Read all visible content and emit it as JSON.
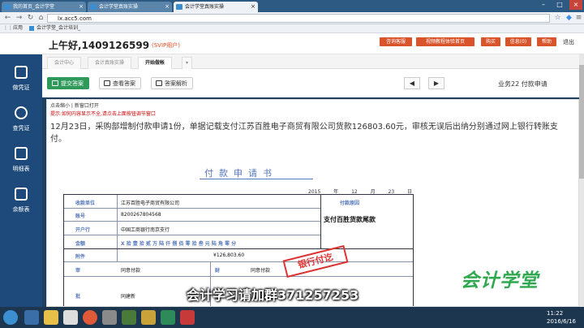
{
  "browser": {
    "tabs": [
      {
        "label": "我的首页_会计学堂"
      },
      {
        "label": "会计学堂真账实操"
      },
      {
        "label": "会计学堂真账实操"
      }
    ],
    "url": "lx.acc5.com",
    "bookmarks": {
      "apps": "应用",
      "item": "会计学堂_会计培训_"
    }
  },
  "header": {
    "greeting": "上午好,1409126599",
    "svip": "(SVIP用户)",
    "buttons": [
      "咨询客服",
      "视频教程体验首页",
      "购买",
      "信息(0)",
      "帮助"
    ],
    "logout": "退出"
  },
  "sidebar": {
    "items": [
      {
        "label": "做凭证"
      },
      {
        "label": "查凭证"
      },
      {
        "label": "明细表"
      },
      {
        "label": "余额表"
      }
    ]
  },
  "tabs": {
    "items": [
      "会计中心",
      "会计真账实操",
      "开始做帐"
    ],
    "dropdown": "▾"
  },
  "toolbar": {
    "submit": "提交答案",
    "view_answer": "查看答案",
    "answer_explain": "答案解析",
    "business_no": "业务22  付款申请"
  },
  "content": {
    "zoom_text": "点击缩小  |  新窗口打开",
    "notice": "提示:如何内容显示不全,请点击上面按钮调节窗口",
    "task": "12月23日，采购部增制付款申请1份，单据记载支付江苏百胜电子商贸有限公司货款126803.60元，审核无误后出纳分别通过网上银行转账支付。"
  },
  "form": {
    "title": "付款申请书",
    "date": "2015 年 12 月 23 日",
    "labels": {
      "payee": "收款单位",
      "account": "账号",
      "bank": "开户行",
      "amount": "金额",
      "attach": "附件",
      "purpose": "付款原因",
      "review": "审",
      "finance": "财",
      "approve": "批"
    },
    "values": {
      "payee": "江苏百胜电子商贸有限公司",
      "account": "8200267804568",
      "bank": "中国工商银行南京支行",
      "amount_words": "X 拾 壹 拾 贰 万 陆 仟 捌 佰 零 拾 叁 元 陆 角 零 分",
      "amount": "¥126,803.60",
      "purpose": "支付百胜货款尾款",
      "review": "同意付款",
      "finance": "同意付款",
      "approve": "同建新",
      "stamp": "银行付讫"
    }
  },
  "overlay": {
    "caption": "会计学习请加群371257253",
    "logo_text": "会计学堂",
    "logo_url": "WWW.ACC5.COM"
  },
  "taskbar": {
    "time": "11:22",
    "date": "2016/6/16"
  },
  "colors": {
    "sidebar": "#1d4a7a",
    "accent": "#d9532b",
    "submit": "#2d9a5a",
    "logo": "#2fa84f"
  }
}
